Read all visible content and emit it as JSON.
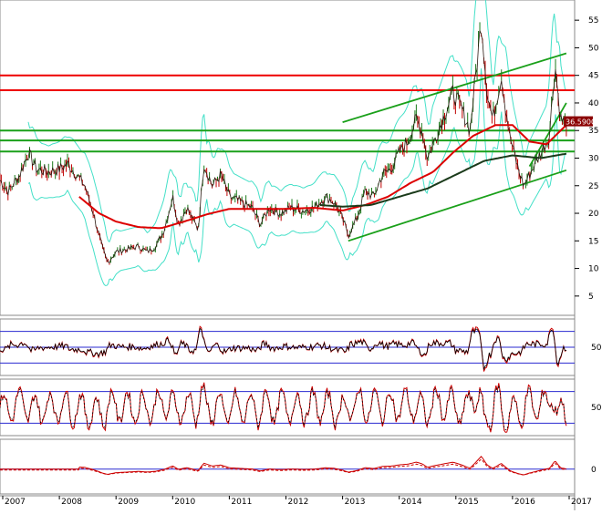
{
  "chart_data": {
    "type": "line",
    "x_ticks": [
      "2007",
      "2008",
      "2009",
      "2010",
      "2011",
      "2012",
      "2013",
      "2014",
      "2015",
      "2016",
      "2017"
    ],
    "price_yticks": [
      5,
      10,
      15,
      20,
      25,
      30,
      35,
      40,
      45,
      50,
      55
    ],
    "price_ylim": [
      2,
      58
    ],
    "last_price_label": "36.5900",
    "colors": {
      "price": "#2b1a12",
      "up_bar": "#1a7a1a",
      "down_bar": "#c00000",
      "ma_red": "#dd0000",
      "ma_dark": "#1a3a1a",
      "bollinger": "#44e0c8",
      "support_resistance_red": "#ee0000",
      "trend_green": "#1aa01a",
      "panel_line_blue": "#2a2ad0",
      "osc_red": "#cc0000",
      "osc_black": "#000000",
      "badge_bg": "#8b0000"
    },
    "horizontal_resistance": [
      45,
      42.3
    ],
    "horizontal_support": [
      35,
      33.2,
      31.2
    ],
    "channel_upper": {
      "x1": 2013.0,
      "y1": 36.5,
      "x2": 2016.95,
      "y2": 49
    },
    "channel_lower": {
      "x1": 2013.1,
      "y1": 15,
      "x2": 2016.95,
      "y2": 27.8
    },
    "short_trend": {
      "x1": 2016.3,
      "y1": 28.5,
      "x2": 2016.95,
      "y2": 40
    },
    "price_keypoints": [
      [
        2006.95,
        26
      ],
      [
        2007.1,
        24
      ],
      [
        2007.3,
        27
      ],
      [
        2007.45,
        31
      ],
      [
        2007.6,
        28
      ],
      [
        2007.8,
        27.5
      ],
      [
        2008.0,
        28
      ],
      [
        2008.15,
        29
      ],
      [
        2008.3,
        27
      ],
      [
        2008.45,
        25
      ],
      [
        2008.6,
        20
      ],
      [
        2008.75,
        14
      ],
      [
        2008.85,
        11
      ],
      [
        2009.0,
        13
      ],
      [
        2009.2,
        13.5
      ],
      [
        2009.4,
        14
      ],
      [
        2009.55,
        13
      ],
      [
        2009.7,
        14
      ],
      [
        2009.85,
        17
      ],
      [
        2010.0,
        23
      ],
      [
        2010.1,
        18
      ],
      [
        2010.25,
        21
      ],
      [
        2010.45,
        17
      ],
      [
        2010.55,
        29
      ],
      [
        2010.7,
        25
      ],
      [
        2010.85,
        27
      ],
      [
        2011.0,
        23
      ],
      [
        2011.2,
        22
      ],
      [
        2011.4,
        21
      ],
      [
        2011.55,
        18
      ],
      [
        2011.7,
        21
      ],
      [
        2011.9,
        20
      ],
      [
        2012.1,
        21
      ],
      [
        2012.3,
        20.5
      ],
      [
        2012.5,
        21
      ],
      [
        2012.7,
        23
      ],
      [
        2012.85,
        22
      ],
      [
        2013.0,
        19
      ],
      [
        2013.1,
        16
      ],
      [
        2013.25,
        19
      ],
      [
        2013.4,
        24
      ],
      [
        2013.55,
        23
      ],
      [
        2013.7,
        27
      ],
      [
        2013.85,
        28
      ],
      [
        2014.0,
        31
      ],
      [
        2014.15,
        33
      ],
      [
        2014.3,
        37
      ],
      [
        2014.4,
        35
      ],
      [
        2014.5,
        30
      ],
      [
        2014.65,
        34
      ],
      [
        2014.8,
        38
      ],
      [
        2014.95,
        42
      ],
      [
        2015.1,
        39
      ],
      [
        2015.25,
        35
      ],
      [
        2015.45,
        55
      ],
      [
        2015.55,
        42
      ],
      [
        2015.65,
        37
      ],
      [
        2015.8,
        45
      ],
      [
        2015.95,
        34
      ],
      [
        2016.1,
        28
      ],
      [
        2016.2,
        25
      ],
      [
        2016.35,
        28
      ],
      [
        2016.5,
        31
      ],
      [
        2016.65,
        34
      ],
      [
        2016.75,
        47
      ],
      [
        2016.85,
        37
      ],
      [
        2016.95,
        36.59
      ]
    ],
    "ma_red_keypoints": [
      [
        2008.35,
        23
      ],
      [
        2008.7,
        20
      ],
      [
        2009.0,
        18.5
      ],
      [
        2009.4,
        17.5
      ],
      [
        2009.8,
        17.3
      ],
      [
        2010.2,
        18.5
      ],
      [
        2010.6,
        19.8
      ],
      [
        2011.0,
        20.8
      ],
      [
        2011.5,
        20.8
      ],
      [
        2012.0,
        20.8
      ],
      [
        2012.5,
        21
      ],
      [
        2013.0,
        20.5
      ],
      [
        2013.4,
        21.5
      ],
      [
        2013.8,
        23
      ],
      [
        2014.2,
        25.5
      ],
      [
        2014.6,
        27.5
      ],
      [
        2014.95,
        31
      ],
      [
        2015.3,
        34
      ],
      [
        2015.7,
        36
      ],
      [
        2016.0,
        36
      ],
      [
        2016.3,
        33
      ],
      [
        2016.6,
        32.5
      ],
      [
        2016.95,
        36
      ]
    ],
    "ma_dark_keypoints": [
      [
        2012.6,
        21.5
      ],
      [
        2013.0,
        21.2
      ],
      [
        2013.5,
        21.5
      ],
      [
        2014.0,
        23
      ],
      [
        2014.5,
        24.5
      ],
      [
        2015.0,
        27
      ],
      [
        2015.5,
        29.5
      ],
      [
        2016.0,
        30.5
      ],
      [
        2016.5,
        30
      ],
      [
        2016.95,
        30.8
      ]
    ],
    "panel1": {
      "label": "50",
      "lines": [
        80,
        50,
        20
      ]
    },
    "panel2": {
      "label": "50",
      "lines": [
        80,
        20
      ]
    },
    "panel3": {
      "label": "0",
      "lines": [
        0
      ]
    }
  }
}
